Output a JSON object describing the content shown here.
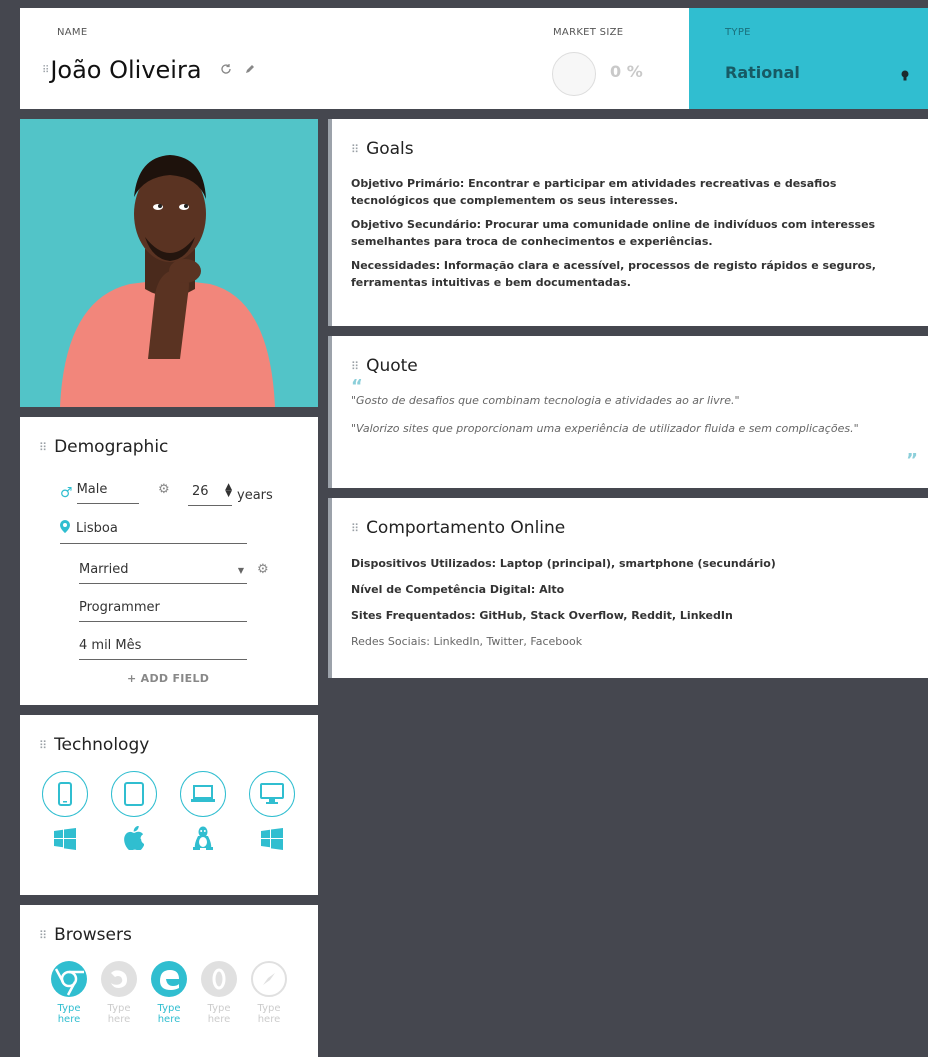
{
  "header": {
    "name_label": "NAME",
    "name": "João Oliveira",
    "market_size_label": "MARKET SIZE",
    "market_size_value": "0 %",
    "type_label": "TYPE",
    "type_value": "Rational"
  },
  "demographic": {
    "title": "Demographic",
    "gender": "Male",
    "age": "26",
    "age_unit": "years",
    "location": "Lisboa",
    "status": "Married",
    "job": "Programmer",
    "income": "4 mil Mês",
    "add_field": "+ ADD FIELD"
  },
  "technology": {
    "title": "Technology",
    "devices": [
      "smartphone-icon",
      "tablet-icon",
      "laptop-icon",
      "desktop-icon"
    ],
    "os": [
      "windows-icon",
      "apple-icon",
      "linux-icon",
      "windows-icon"
    ]
  },
  "browsers": {
    "title": "Browsers",
    "items": [
      {
        "icon": "chrome-icon",
        "label": "Type here",
        "active": true
      },
      {
        "icon": "firefox-icon",
        "label": "Type here",
        "active": false
      },
      {
        "icon": "edge-icon",
        "label": "Type here",
        "active": true
      },
      {
        "icon": "opera-icon",
        "label": "Type here",
        "active": false
      },
      {
        "icon": "safari-icon",
        "label": "Type here",
        "active": false
      }
    ]
  },
  "goals": {
    "title": "Goals",
    "p1": "Objetivo Primário: Encontrar e participar em atividades recreativas e desafios tecnológicos que complementem os seus interesses.",
    "p2": "Objetivo Secundário: Procurar uma comunidade online de indivíduos com interesses semelhantes para troca de conhecimentos e experiências.",
    "p3": "Necessidades: Informação clara e acessível, processos de registo rápidos e seguros, ferramentas intuitivas e bem documentadas."
  },
  "quote": {
    "title": "Quote",
    "q1": "\"Gosto de desafios que combinam tecnologia e atividades ao ar livre.\"",
    "q2": "\"Valorizo sites que proporcionam uma experiência de utilizador fluida e sem complicações.\""
  },
  "online": {
    "title": "Comportamento Online",
    "p1": "Dispositivos Utilizados: Laptop (principal), smartphone (secundário)",
    "p2": "Nível de Competência Digital: Alto",
    "p3": "Sites Frequentados: GitHub, Stack Overflow, Reddit, LinkedIn",
    "p4": "Redes Sociais: LinkedIn, Twitter, Facebook"
  },
  "colors": {
    "accent": "#30bed0",
    "background": "#45474f",
    "photo_bg": "#52c4c8"
  }
}
